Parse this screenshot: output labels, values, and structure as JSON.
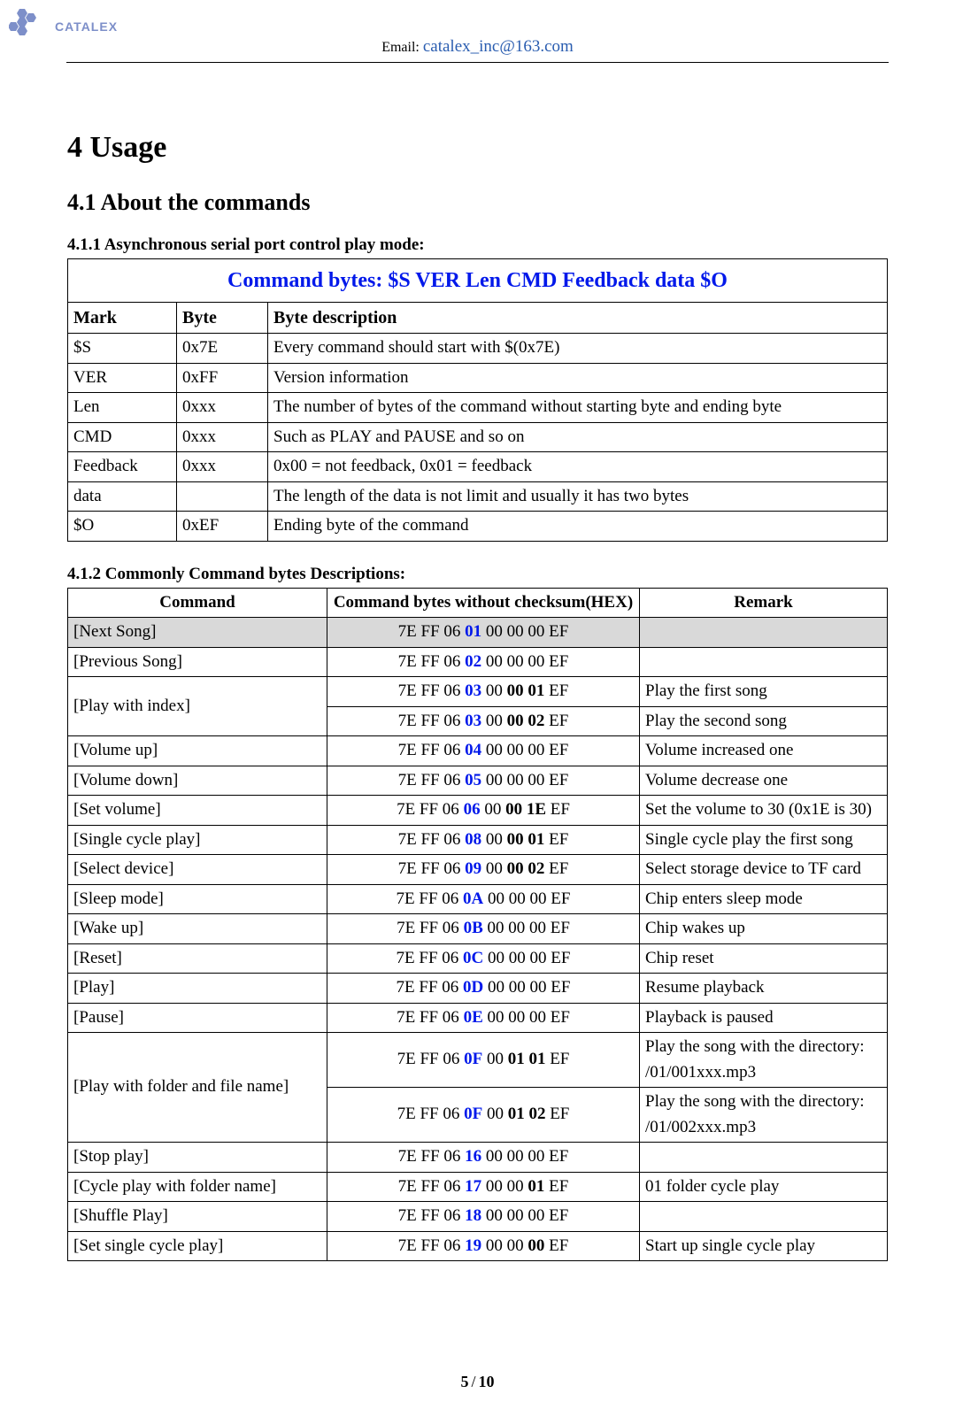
{
  "header": {
    "brand": "CATALEX",
    "email_label": "Email: ",
    "email": "catalex_inc@163.com"
  },
  "titles": {
    "h1": "4 Usage",
    "h2": "4.1 About the commands",
    "sub1": "4.1.1 Asynchronous serial port control play mode:",
    "sub2": "4.1.2 Commonly Command bytes Descriptions:"
  },
  "table1": {
    "title": "Command bytes: $S VER Len CMD Feedback data $O",
    "headers": {
      "c1": "Mark",
      "c2": "Byte",
      "c3": "Byte description"
    },
    "rows": [
      {
        "mark": "$S",
        "byte": "0x7E",
        "desc": "Every command should start with $(0x7E)"
      },
      {
        "mark": "VER",
        "byte": "0xFF",
        "desc": "Version information"
      },
      {
        "mark": "Len",
        "byte": "0xxx",
        "desc": "The number of bytes of the command without starting byte and ending byte"
      },
      {
        "mark": "CMD",
        "byte": "0xxx",
        "desc": "Such as PLAY and PAUSE and so on"
      },
      {
        "mark": "Feedback",
        "byte": "0xxx",
        "desc": "0x00 = not feedback, 0x01 = feedback"
      },
      {
        "mark": "data",
        "byte": "",
        "desc": "The length of the data is not limit and usually it has two bytes"
      },
      {
        "mark": "$O",
        "byte": "0xEF",
        "desc": "Ending byte of the command"
      }
    ]
  },
  "table2": {
    "headers": {
      "c1": "Command",
      "c2": "Command bytes without checksum(HEX)",
      "c3": "Remark"
    },
    "prefix": "7E FF 06 ",
    "sp_sep": " 00 ",
    "suffix": " EF",
    "rows": [
      {
        "shade": true,
        "rowspan": 1,
        "cmd": "[Next Song]",
        "b1": "01",
        "d": "00 00",
        "remark": ""
      },
      {
        "shade": false,
        "rowspan": 1,
        "cmd": "[Previous Song]",
        "b1": "02",
        "d": "00 00",
        "remark": ""
      },
      {
        "shade": false,
        "rowspan": 2,
        "cmd": "[Play with index]",
        "b1": "03",
        "d": "00 01",
        "dbold": true,
        "remark": "Play the first song"
      },
      {
        "shade": false,
        "rowspan": 0,
        "cmd": "",
        "b1": "03",
        "d": "00 02",
        "dbold": true,
        "remark": "Play the second song"
      },
      {
        "shade": false,
        "rowspan": 1,
        "cmd": "[Volume up]",
        "b1": "04",
        "d": "00 00",
        "remark": "Volume increased one"
      },
      {
        "shade": false,
        "rowspan": 1,
        "cmd": "[Volume down]",
        "b1": "05",
        "d": "00 00",
        "remark": "Volume decrease one"
      },
      {
        "shade": false,
        "rowspan": 1,
        "cmd": "[Set volume]",
        "b1": "06",
        "d": "00 1E",
        "dbold": true,
        "remark": "Set the volume to 30 (0x1E is 30)"
      },
      {
        "shade": false,
        "rowspan": 1,
        "cmd": "[Single cycle play]",
        "b1": "08",
        "d": "00 01",
        "dbold": true,
        "remark": "Single cycle play the first song"
      },
      {
        "shade": false,
        "rowspan": 1,
        "cmd": "[Select device]",
        "b1": "09",
        "d": "00 02",
        "dbold": true,
        "remark": "Select storage device to TF card"
      },
      {
        "shade": false,
        "rowspan": 1,
        "cmd": "[Sleep mode]",
        "b1": "0A",
        "d": "00 00",
        "remark": "Chip enters sleep mode"
      },
      {
        "shade": false,
        "rowspan": 1,
        "cmd": "[Wake up]",
        "b1": "0B",
        "d": "00 00",
        "remark": "Chip wakes up"
      },
      {
        "shade": false,
        "rowspan": 1,
        "cmd": "[Reset]",
        "b1": "0C",
        "d": "00 00",
        "remark": "Chip reset"
      },
      {
        "shade": false,
        "rowspan": 1,
        "cmd": "[Play]",
        "b1": "0D",
        "d": "00 00",
        "remark": "Resume playback"
      },
      {
        "shade": false,
        "rowspan": 1,
        "cmd": "[Pause]",
        "b1": "0E",
        "d": "00 00",
        "remark": "Playback is paused"
      },
      {
        "shade": false,
        "rowspan": 2,
        "cmd": "[Play with folder and file name]",
        "b1": "0F",
        "d": "01 01",
        "dbold": true,
        "remark": "Play the song with the directory: /01/001xxx.mp3"
      },
      {
        "shade": false,
        "rowspan": 0,
        "cmd": "",
        "b1": "0F",
        "d": "01 02",
        "dbold": true,
        "remark": "Play the song with the directory: /01/002xxx.mp3"
      },
      {
        "shade": false,
        "rowspan": 1,
        "cmd": "[Stop play]",
        "b1": "16",
        "d": "00 00",
        "remark": ""
      },
      {
        "shade": false,
        "rowspan": 1,
        "cmd": "[Cycle play with folder name]",
        "b1": "17",
        "d": "00",
        "tail_bold": "01",
        "remark": "01 folder cycle play"
      },
      {
        "shade": false,
        "rowspan": 1,
        "cmd": "[Shuffle Play]",
        "b1": "18",
        "d": "00 00",
        "remark": ""
      },
      {
        "shade": false,
        "rowspan": 1,
        "cmd": "[Set single cycle play]",
        "b1": "19",
        "d": "00",
        "tail_bold": "00",
        "remark": "Start up single cycle play"
      }
    ]
  },
  "footer": {
    "page": "5",
    "total": "10",
    "sep": "/"
  }
}
